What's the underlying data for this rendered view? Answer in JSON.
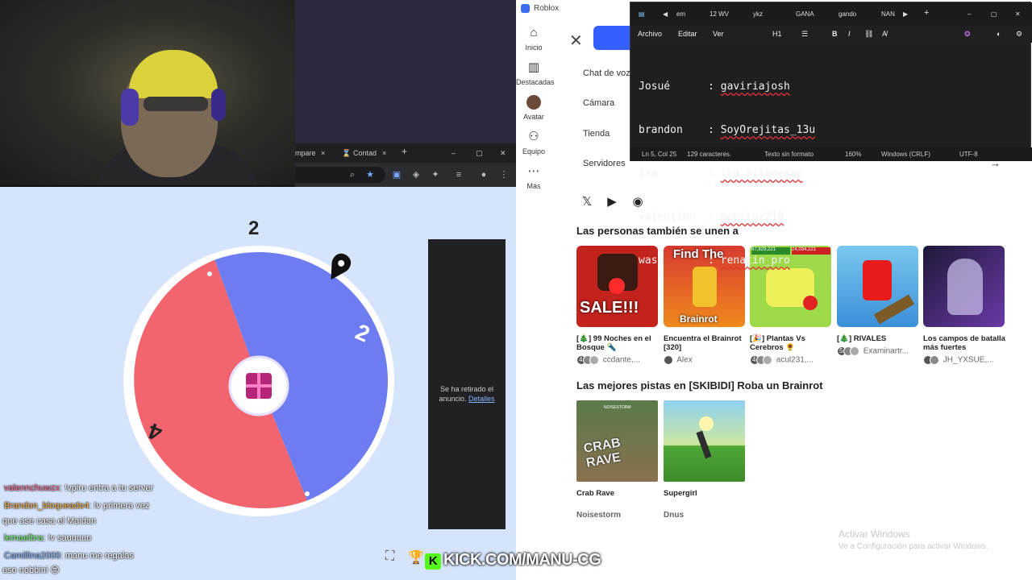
{
  "chrome": {
    "tabs": [
      {
        "label": "mpare",
        "close": "×"
      },
      {
        "label": "Contad",
        "close": "×"
      }
    ],
    "new_tab": "+"
  },
  "wheel": {
    "count_label": "2",
    "segments": [
      {
        "label": "2",
        "color": "#6e7cf2"
      },
      {
        "label": "4",
        "color": "#f2656f"
      }
    ],
    "gift_icon": "gift-icon",
    "pointer_icon": "map-pin-icon",
    "ad_text": "Se ha retirado el anuncio.",
    "ad_link": "Detalles"
  },
  "chat": [
    {
      "user": "valennchuwzx",
      "msg": ": !vpiru entra a tu server"
    },
    {
      "user": "Brandon_bloqueado4",
      "msg": ": !v primera vez"
    },
    {
      "user": "",
      "msg": "que ase casa el Maidan"
    },
    {
      "user": "lemaelbra",
      "msg": ": !v sauuuuu"
    },
    {
      "user": "Camillina2000",
      "msg": ": manu me regalas"
    },
    {
      "user": "",
      "msg": "eso nobbini 😍"
    }
  ],
  "kick_banner": "KICK.COM/MANU-CG",
  "roblox": {
    "window_title": "Roblox",
    "nav": [
      {
        "label": "Inicio",
        "icon": "home-icon"
      },
      {
        "label": "Destacadas",
        "icon": "chart-icon"
      },
      {
        "label": "Avatar",
        "icon": "avatar-icon"
      },
      {
        "label": "Equipo",
        "icon": "team-icon"
      },
      {
        "label": "Más",
        "icon": "more-icon"
      }
    ],
    "menu": [
      "Chat de voz",
      "Cámara",
      "Tienda",
      "Servidores"
    ],
    "section1": "Las personas también se unen a",
    "games": [
      {
        "name": "[🎄] 99 Noches en el Bosque 🔦",
        "count": "4",
        "creator": "ccdante,..."
      },
      {
        "name": "Encuentra el Brainrot [320]",
        "count": "",
        "creator": "Alex"
      },
      {
        "name": "[🎉] Plantas Vs Cerebros 🌻",
        "count": "4",
        "creator": "acul231,..."
      },
      {
        "name": "[🎄] RIVALES",
        "count": "5",
        "creator": "Examinartr..."
      },
      {
        "name": "Los campos de batalla más fuertes",
        "count": "",
        "creator": "JH_YXSUE,..."
      }
    ],
    "thumb_text": {
      "sale": "SALE!!!",
      "find": "Find The",
      "brainrot": "Brainrot",
      "bar1": "67,829,221",
      "bar2": "24,034,221",
      "crab": "CRAB RAVE",
      "noisestorm_tag": "NOISESTORM"
    },
    "section2": "Las mejores pistas en [SKIBIDI] Roba un Brainrot",
    "tracks": [
      {
        "name": "Crab Rave",
        "artist": "Noisestorm"
      },
      {
        "name": "Supergirl",
        "artist": "Dnus"
      }
    ],
    "activate_title": "Activar Windows",
    "activate_sub": "Ve a Configuración para activar Windows."
  },
  "notepad": {
    "tabs": [
      "em",
      "12 WV",
      "ykz",
      "GANA",
      "gando",
      "NAN"
    ],
    "menu": [
      "Archivo",
      "Editar",
      "Ver"
    ],
    "heading": "H1",
    "lines": [
      {
        "name": "Josué      ",
        "value": "gaviriajosh"
      },
      {
        "name": "brandon    ",
        "value": "SoyOrejitas_13u"
      },
      {
        "name": "isa        ",
        "value": "isa_milanesap"
      },
      {
        "name": "valentino  ",
        "value": "pepitox218"
      },
      {
        "name": "wasa       ",
        "value": "renatin_pro"
      }
    ],
    "status": [
      "Ln 5, Col 25",
      "129 caracteres.",
      "Texto sin formato",
      "160%",
      "Windows (CRLF)",
      "UTF-8"
    ]
  }
}
